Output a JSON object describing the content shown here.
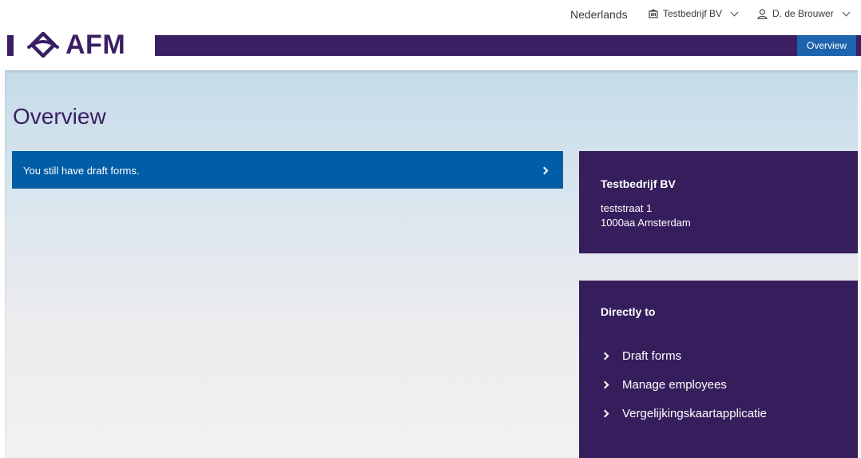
{
  "topbar": {
    "language": "Nederlands",
    "company": "Testbedrijf BV",
    "user": "D. de Brouwer"
  },
  "logo": {
    "text": "AFM"
  },
  "nav": {
    "tabs": [
      {
        "label": "Overview",
        "active": true
      }
    ]
  },
  "page": {
    "title": "Overview"
  },
  "draft_banner": {
    "text": "You still have draft forms."
  },
  "company_card": {
    "name": "Testbedrijf BV",
    "address_line1": "teststraat 1",
    "address_line2": "1000aa Amsterdam"
  },
  "directly_to": {
    "heading": "Directly to",
    "links": [
      {
        "label": "Draft forms"
      },
      {
        "label": "Manage employees"
      },
      {
        "label": "Vergelijkingskaartapplicatie"
      }
    ]
  },
  "colors": {
    "brand_purple": "#3a1f63",
    "card_purple": "#361e5c",
    "accent_blue": "#005da6",
    "nav_active": "#1d63ad"
  },
  "icons": {
    "company": "building-icon",
    "user": "user-icon",
    "logo": "afm-logo-icon"
  }
}
